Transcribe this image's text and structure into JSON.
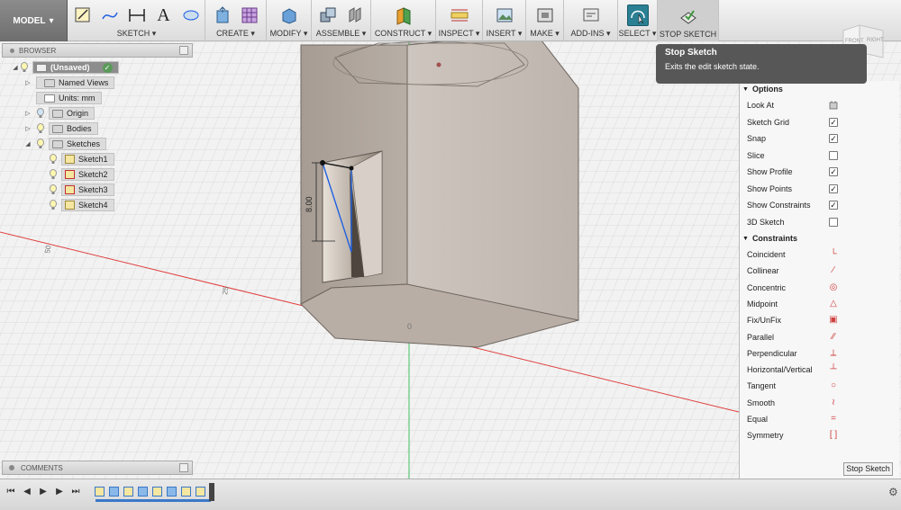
{
  "toolbar": {
    "mode_button": "MODEL",
    "groups": {
      "sketch": "SKETCH ▾",
      "create": "CREATE ▾",
      "modify": "MODIFY ▾",
      "assemble": "ASSEMBLE ▾",
      "construct": "CONSTRUCT ▾",
      "inspect": "INSPECT ▾",
      "insert": "INSERT ▾",
      "make": "MAKE ▾",
      "addins": "ADD-INS ▾",
      "select": "SELECT ▾",
      "stop_sketch": "STOP SKETCH"
    }
  },
  "browser": {
    "title": "BROWSER",
    "root": "(Unsaved)",
    "items": [
      {
        "label": "Named Views"
      },
      {
        "label": "Units: mm"
      },
      {
        "label": "Origin"
      },
      {
        "label": "Bodies"
      },
      {
        "label": "Sketches"
      }
    ],
    "sketches": [
      "Sketch1",
      "Sketch2",
      "Sketch3",
      "Sketch4"
    ]
  },
  "comments": {
    "title": "COMMENTS"
  },
  "tooltip": {
    "title": "Stop Sketch",
    "description": "Exits the edit sketch state."
  },
  "viewport": {
    "dimension_label": "8.00",
    "axis_labels": [
      "50",
      "25",
      "0"
    ]
  },
  "viewcube": {
    "front": "FRONT",
    "right": "RIGHT"
  },
  "palette": {
    "options_title": "Options",
    "options": [
      {
        "label": "Look At",
        "control": "icon"
      },
      {
        "label": "Sketch Grid",
        "checked": true
      },
      {
        "label": "Snap",
        "checked": true
      },
      {
        "label": "Slice",
        "checked": false
      },
      {
        "label": "Show Profile",
        "checked": true
      },
      {
        "label": "Show Points",
        "checked": true
      },
      {
        "label": "Show Constraints",
        "checked": true
      },
      {
        "label": "3D Sketch",
        "checked": false
      }
    ],
    "constraints_title": "Constraints",
    "constraints": [
      {
        "label": "Coincident",
        "icon": "coincident-icon",
        "glyph": "└"
      },
      {
        "label": "Collinear",
        "icon": "collinear-icon",
        "glyph": "⁄"
      },
      {
        "label": "Concentric",
        "icon": "concentric-icon",
        "glyph": "◎"
      },
      {
        "label": "Midpoint",
        "icon": "midpoint-icon",
        "glyph": "△"
      },
      {
        "label": "Fix/UnFix",
        "icon": "lock-icon",
        "glyph": "▣"
      },
      {
        "label": "Parallel",
        "icon": "parallel-icon",
        "glyph": "∕∕"
      },
      {
        "label": "Perpendicular",
        "icon": "perpendicular-icon",
        "glyph": "⟂"
      },
      {
        "label": "Horizontal/Vertical",
        "icon": "horizontal-vertical-icon",
        "glyph": "┴"
      },
      {
        "label": "Tangent",
        "icon": "tangent-icon",
        "glyph": "○"
      },
      {
        "label": "Smooth",
        "icon": "smooth-icon",
        "glyph": "≀"
      },
      {
        "label": "Equal",
        "icon": "equal-icon",
        "glyph": "="
      },
      {
        "label": "Symmetry",
        "icon": "symmetry-icon",
        "glyph": "[ ]"
      }
    ],
    "stop_button": "Stop Sketch"
  },
  "colors": {
    "accent": "#2a7f93",
    "constraint_icon": "#d04040",
    "tooltip_bg": "#575757",
    "red_axis": "#e04040",
    "green_axis": "#40c060",
    "sketch_line": "#2060e0"
  }
}
